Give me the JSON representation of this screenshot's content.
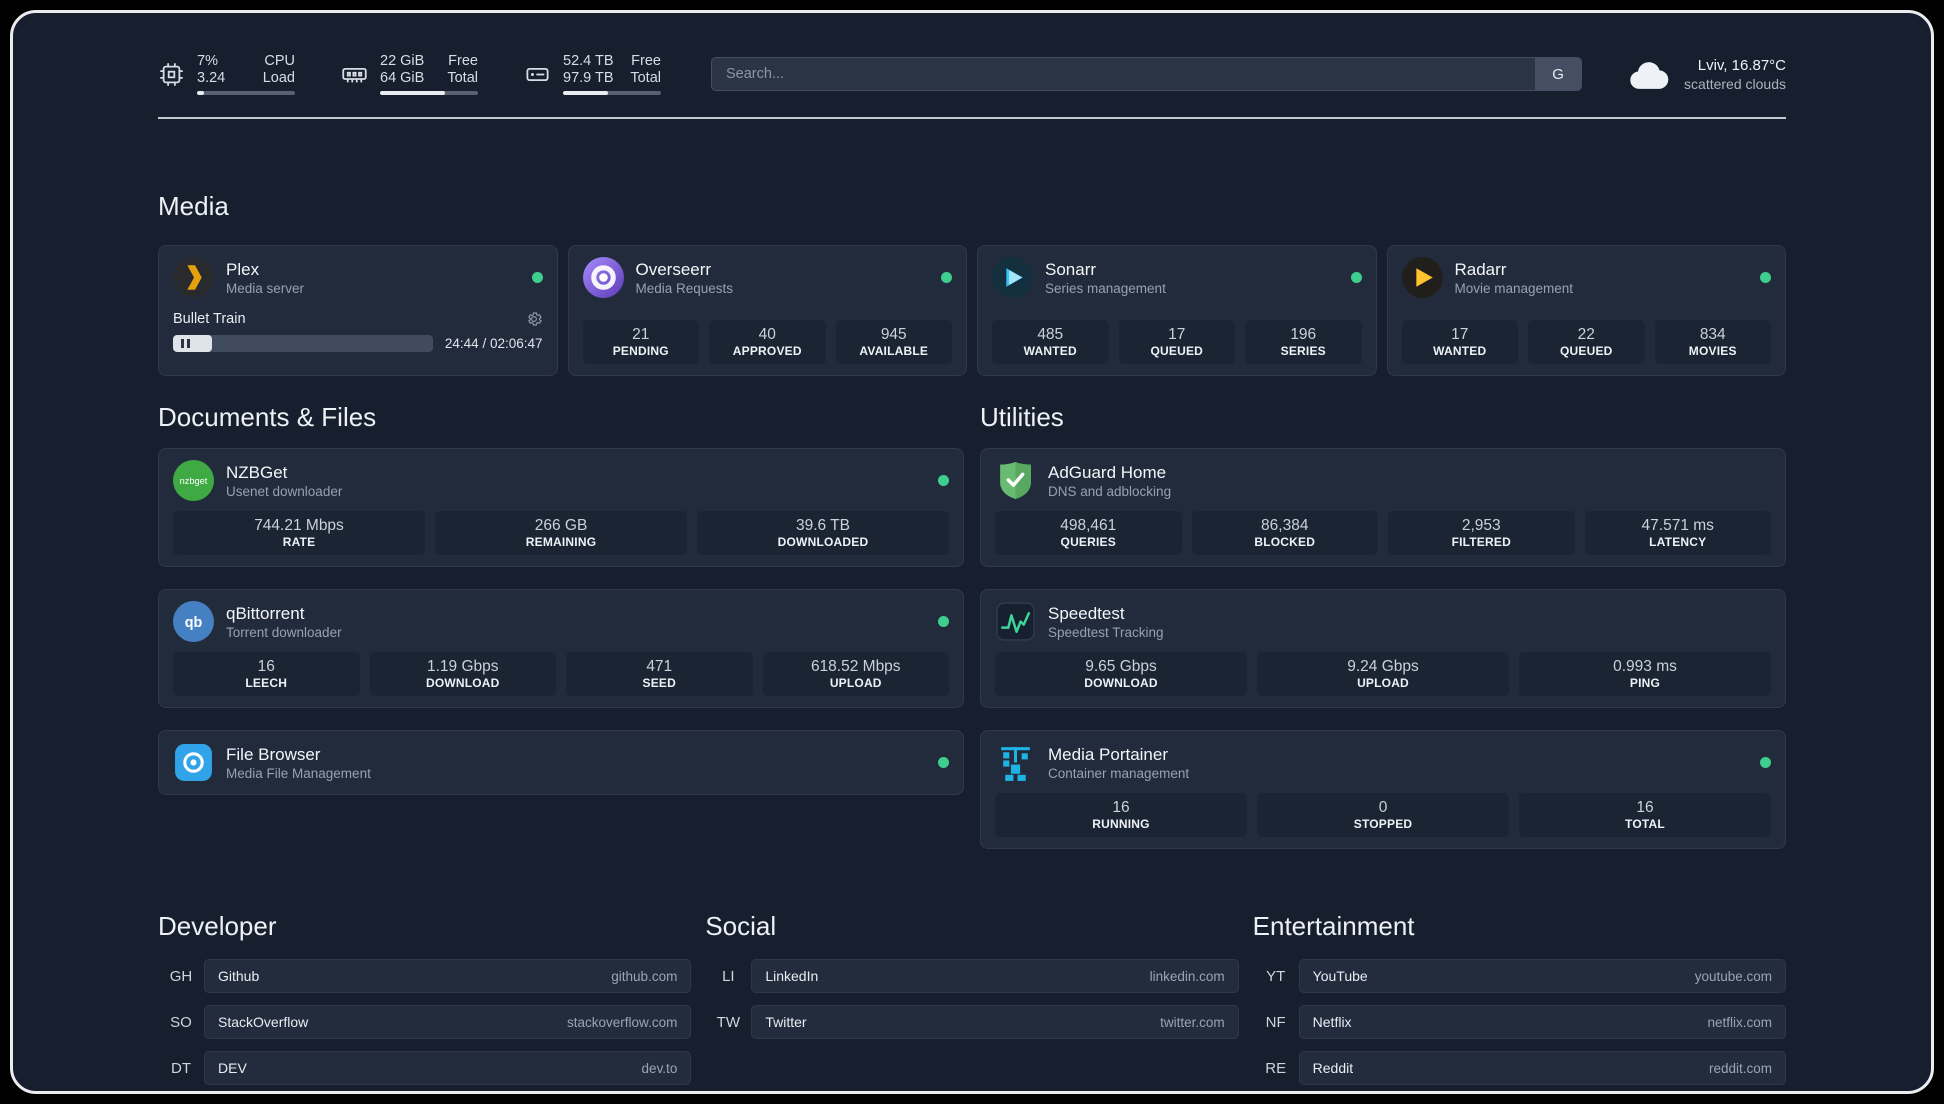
{
  "header": {
    "cpu": {
      "percent": "7%",
      "load": "3.24",
      "label_top": "CPU",
      "label_bottom": "Load",
      "fill": "7%"
    },
    "memory": {
      "free": "22 GiB",
      "total": "64 GiB",
      "label_top": "Free",
      "label_bottom": "Total",
      "fill": "66%"
    },
    "disk": {
      "free": "52.4 TB",
      "total": "97.9 TB",
      "label_top": "Free",
      "label_bottom": "Total",
      "fill": "46%"
    },
    "search": {
      "placeholder": "Search...",
      "provider": "G"
    },
    "weather": {
      "location": "Lviv, 16.87°C",
      "condition": "scattered clouds"
    }
  },
  "sections": {
    "media": {
      "title": "Media",
      "plex": {
        "name": "Plex",
        "description": "Media server",
        "status": "online",
        "player": {
          "title": "Bullet Train",
          "time": "24:44 / 02:06:47",
          "progress": "15%"
        }
      },
      "overseerr": {
        "name": "Overseerr",
        "description": "Media Requests",
        "status": "online",
        "stats": [
          {
            "value": "21",
            "label": "PENDING"
          },
          {
            "value": "40",
            "label": "APPROVED"
          },
          {
            "value": "945",
            "label": "AVAILABLE"
          }
        ]
      },
      "sonarr": {
        "name": "Sonarr",
        "description": "Series management",
        "status": "online",
        "stats": [
          {
            "value": "485",
            "label": "WANTED"
          },
          {
            "value": "17",
            "label": "QUEUED"
          },
          {
            "value": "196",
            "label": "SERIES"
          }
        ]
      },
      "radarr": {
        "name": "Radarr",
        "description": "Movie management",
        "status": "online",
        "stats": [
          {
            "value": "17",
            "label": "WANTED"
          },
          {
            "value": "22",
            "label": "QUEUED"
          },
          {
            "value": "834",
            "label": "MOVIES"
          }
        ]
      }
    },
    "documents": {
      "title": "Documents & Files",
      "nzbget": {
        "name": "NZBGet",
        "description": "Usenet downloader",
        "status": "online",
        "stats": [
          {
            "value": "744.21 Mbps",
            "label": "RATE"
          },
          {
            "value": "266 GB",
            "label": "REMAINING"
          },
          {
            "value": "39.6 TB",
            "label": "DOWNLOADED"
          }
        ]
      },
      "qbittorrent": {
        "name": "qBittorrent",
        "description": "Torrent downloader",
        "status": "online",
        "stats": [
          {
            "value": "16",
            "label": "LEECH"
          },
          {
            "value": "1.19 Gbps",
            "label": "DOWNLOAD"
          },
          {
            "value": "471",
            "label": "SEED"
          },
          {
            "value": "618.52 Mbps",
            "label": "UPLOAD"
          }
        ]
      },
      "filebrowser": {
        "name": "File Browser",
        "description": "Media File Management",
        "status": "online"
      }
    },
    "utilities": {
      "title": "Utilities",
      "adguard": {
        "name": "AdGuard Home",
        "description": "DNS and adblocking",
        "stats": [
          {
            "value": "498,461",
            "label": "QUERIES"
          },
          {
            "value": "86,384",
            "label": "BLOCKED"
          },
          {
            "value": "2,953",
            "label": "FILTERED"
          },
          {
            "value": "47.571 ms",
            "label": "LATENCY"
          }
        ]
      },
      "speedtest": {
        "name": "Speedtest",
        "description": "Speedtest Tracking",
        "stats": [
          {
            "value": "9.65 Gbps",
            "label": "DOWNLOAD"
          },
          {
            "value": "9.24 Gbps",
            "label": "UPLOAD"
          },
          {
            "value": "0.993 ms",
            "label": "PING"
          }
        ]
      },
      "portainer": {
        "name": "Media Portainer",
        "description": "Container management",
        "status": "online",
        "stats": [
          {
            "value": "16",
            "label": "RUNNING"
          },
          {
            "value": "0",
            "label": "STOPPED"
          },
          {
            "value": "16",
            "label": "TOTAL"
          }
        ]
      }
    },
    "bookmarks": {
      "developer": {
        "title": "Developer",
        "items": [
          {
            "abbr": "GH",
            "name": "Github",
            "url": "github.com"
          },
          {
            "abbr": "SO",
            "name": "StackOverflow",
            "url": "stackoverflow.com"
          },
          {
            "abbr": "DT",
            "name": "DEV",
            "url": "dev.to"
          }
        ]
      },
      "social": {
        "title": "Social",
        "items": [
          {
            "abbr": "LI",
            "name": "LinkedIn",
            "url": "linkedin.com"
          },
          {
            "abbr": "TW",
            "name": "Twitter",
            "url": "twitter.com"
          }
        ]
      },
      "entertainment": {
        "title": "Entertainment",
        "items": [
          {
            "abbr": "YT",
            "name": "YouTube",
            "url": "youtube.com"
          },
          {
            "abbr": "NF",
            "name": "Netflix",
            "url": "netflix.com"
          },
          {
            "abbr": "RE",
            "name": "Reddit",
            "url": "reddit.com"
          }
        ]
      }
    }
  }
}
